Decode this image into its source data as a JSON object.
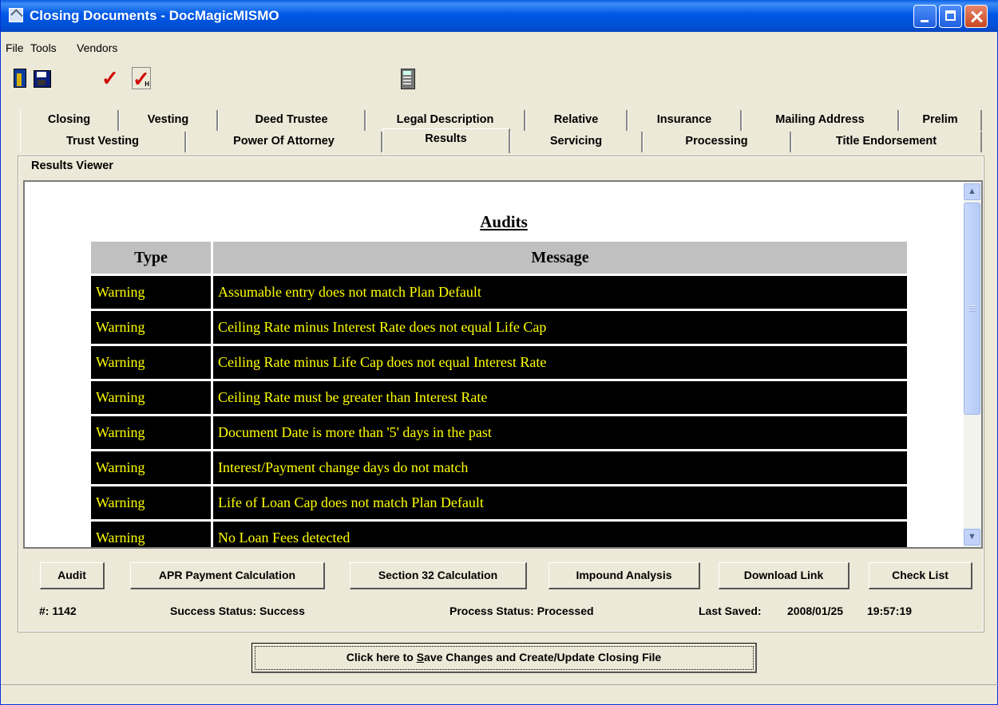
{
  "window": {
    "title": "Closing Documents - DocMagicMISMO"
  },
  "menu": [
    "File",
    "Tools",
    "Vendors"
  ],
  "toolbar": {
    "icons": [
      "exit-icon",
      "save-icon",
      "check-icon",
      "check-h-icon",
      "calculator-icon"
    ],
    "check_h_label": "H"
  },
  "tabs_row1": [
    "Closing",
    "Vesting",
    "Deed Trustee",
    "Legal Description",
    "Relative",
    "Insurance",
    "Mailing Address",
    "Prelim"
  ],
  "tabs_row2": [
    "Trust Vesting",
    "Power Of Attorney",
    "Results",
    "Servicing",
    "Processing",
    "Title Endorsement"
  ],
  "active_tab": "Results",
  "viewer": {
    "legend": "Results Viewer",
    "heading": "Audits",
    "columns": [
      "Type",
      "Message"
    ],
    "rows": [
      {
        "type": "Warning",
        "message": "Assumable entry does not match Plan Default"
      },
      {
        "type": "Warning",
        "message": "Ceiling Rate minus Interest Rate does not equal Life Cap"
      },
      {
        "type": "Warning",
        "message": "Ceiling Rate minus Life Cap does not equal Interest Rate"
      },
      {
        "type": "Warning",
        "message": "Ceiling Rate must be greater than Interest Rate"
      },
      {
        "type": "Warning",
        "message": "Document Date is more than '5' days in the past"
      },
      {
        "type": "Warning",
        "message": "Interest/Payment change days do not match"
      },
      {
        "type": "Warning",
        "message": "Life of Loan Cap does not match Plan Default"
      },
      {
        "type": "Warning",
        "message": "No Loan Fees detected"
      }
    ],
    "colors": {
      "row_bg": "#000000",
      "row_text": "#ffff00",
      "header_bg": "#c0c0c0"
    }
  },
  "actions": {
    "audit": "Audit",
    "apr": "APR Payment Calculation",
    "section32": "Section 32 Calculation",
    "impound": "Impound Analysis",
    "download": "Download Link",
    "checklist": "Check List"
  },
  "status": {
    "number": "#: 1142",
    "success": "Success Status: Success",
    "process": "Process Status: Processed",
    "saved_label": "Last Saved:",
    "saved_date": "2008/01/25",
    "saved_time": "19:57:19"
  },
  "main_button": {
    "prefix": "Click here to ",
    "accel": "S",
    "rest": "ave Changes and Create/Update Closing File"
  }
}
